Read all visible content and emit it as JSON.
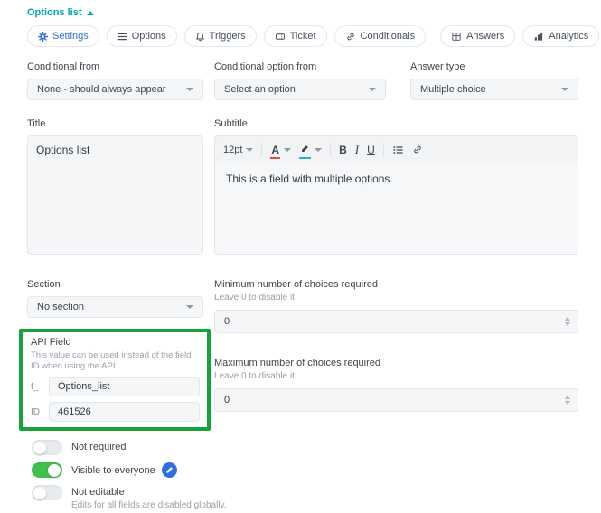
{
  "colors": {
    "accent_blue": "#2e6fd8",
    "teal_link": "#00a7b5",
    "toggle_on_green": "#3ec14d",
    "annotation_green": "#18a23b",
    "edit_icon_blue": "#2b6fe0"
  },
  "header": {
    "title": "Options list",
    "collapse_icon": "chevron-up-icon"
  },
  "tabs": {
    "left": [
      {
        "label": "Settings",
        "icon": "gear-icon",
        "active": true
      },
      {
        "label": "Options",
        "icon": "list-icon",
        "active": false
      },
      {
        "label": "Triggers",
        "icon": "bell-icon",
        "active": false
      },
      {
        "label": "Ticket",
        "icon": "ticket-icon",
        "active": false
      },
      {
        "label": "Conditionals",
        "icon": "link-icon",
        "active": false
      }
    ],
    "right": [
      {
        "label": "Answers",
        "icon": "grid-icon",
        "active": false
      },
      {
        "label": "Analytics",
        "icon": "chart-icon",
        "active": false
      }
    ]
  },
  "selects": {
    "conditional_from": {
      "label": "Conditional from",
      "value": "None - should always appear"
    },
    "conditional_option_from": {
      "label": "Conditional option from",
      "value": "Select an option"
    },
    "answer_type": {
      "label": "Answer type",
      "value": "Multiple choice"
    }
  },
  "title_field": {
    "label": "Title",
    "value": "Options list"
  },
  "subtitle_field": {
    "label": "Subtitle",
    "value": "This is a field with multiple options.",
    "toolbar": {
      "font_size": "12pt",
      "color_label": "A",
      "bold_label": "B",
      "italic_label": "I",
      "underline_label": "U",
      "icons": [
        "font-size-select",
        "text-color-icon",
        "highlight-icon",
        "bold-button",
        "italic-button",
        "underline-button",
        "bullet-list-icon",
        "insert-link-icon"
      ]
    }
  },
  "section_field": {
    "label": "Section",
    "value": "No section"
  },
  "min_choices": {
    "label": "Minimum number of choices required",
    "hint": "Leave 0 to disable it.",
    "value": "0"
  },
  "max_choices": {
    "label": "Maximum number of choices required",
    "hint": "Leave 0 to disable it.",
    "value": "0"
  },
  "api_field": {
    "label": "API Field",
    "description": "This value can be used instead of the field ID when using the API.",
    "name_prefix": "f_",
    "name_value": "Options_list",
    "id_prefix": "ID",
    "id_value": "461526"
  },
  "toggles": {
    "not_required": {
      "label": "Not required",
      "on": false
    },
    "visible": {
      "label": "Visible to everyone",
      "on": true
    },
    "not_editable": {
      "label": "Not editable",
      "on": false,
      "hint": "Edits for all fields are disabled globally."
    }
  }
}
